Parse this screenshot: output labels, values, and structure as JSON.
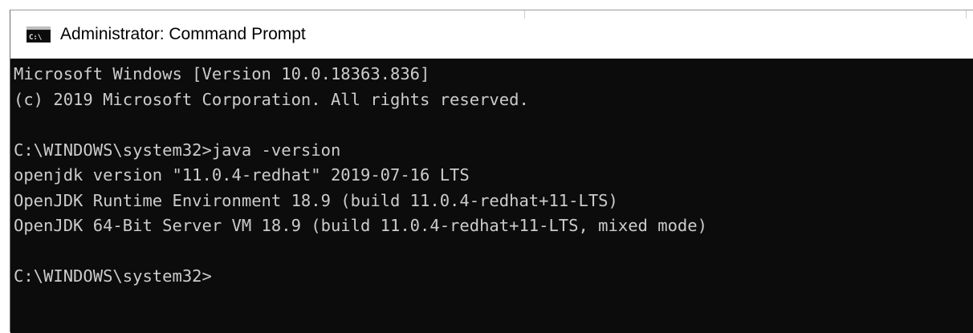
{
  "window": {
    "title": "Administrator: Command Prompt",
    "icon": "cmd-icon"
  },
  "console": {
    "lines": [
      "Microsoft Windows [Version 10.0.18363.836]",
      "(c) 2019 Microsoft Corporation. All rights reserved.",
      "",
      "C:\\WINDOWS\\system32>java -version",
      "openjdk version \"11.0.4-redhat\" 2019-07-16 LTS",
      "OpenJDK Runtime Environment 18.9 (build 11.0.4-redhat+11-LTS)",
      "OpenJDK 64-Bit Server VM 18.9 (build 11.0.4-redhat+11-LTS, mixed mode)",
      "",
      "C:\\WINDOWS\\system32>"
    ]
  },
  "colors": {
    "console_bg": "#0c0c0c",
    "console_text": "#cccccc",
    "titlebar_bg": "#ffffff"
  }
}
